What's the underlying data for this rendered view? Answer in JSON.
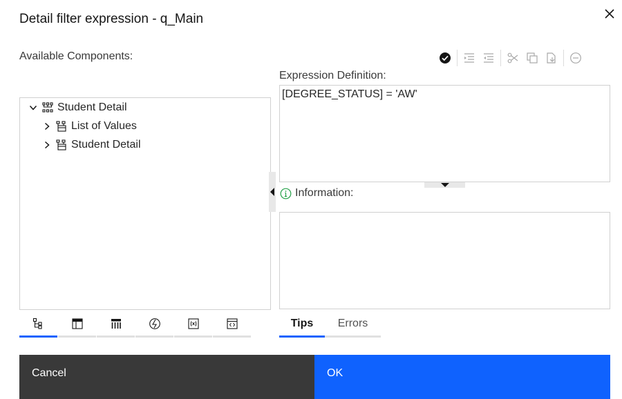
{
  "dialog": {
    "title": "Detail filter expression - q_Main"
  },
  "labels": {
    "available_components": "Available Components:",
    "expression_definition": "Expression Definition:",
    "information": "Information:"
  },
  "toolbar": {
    "icons": [
      "validate-check-icon",
      "indent-icon",
      "outdent-icon",
      "cut-icon",
      "copy-icon",
      "paste-icon",
      "remove-icon"
    ]
  },
  "tree": {
    "items": [
      {
        "label": "Student Detail",
        "expanded": true,
        "level": 0,
        "icon": "package-icon"
      },
      {
        "label": "List of Values",
        "expanded": false,
        "level": 1,
        "icon": "query-subject-icon"
      },
      {
        "label": "Student Detail",
        "expanded": false,
        "level": 1,
        "icon": "query-subject-icon"
      }
    ]
  },
  "expression": {
    "text": "[DEGREE_STATUS] = 'AW'"
  },
  "left_tabs": {
    "icons": [
      "source-tree-icon",
      "data-items-icon",
      "parameters-icon",
      "functions-icon",
      "variables-icon",
      "macros-icon"
    ],
    "active": 0
  },
  "right_tabs": {
    "tips": "Tips",
    "errors": "Errors",
    "active": "tips"
  },
  "footer": {
    "cancel": "Cancel",
    "ok": "OK"
  },
  "colors": {
    "primary": "#0f62fe",
    "secondary": "#393939",
    "info_green": "#24a148"
  }
}
